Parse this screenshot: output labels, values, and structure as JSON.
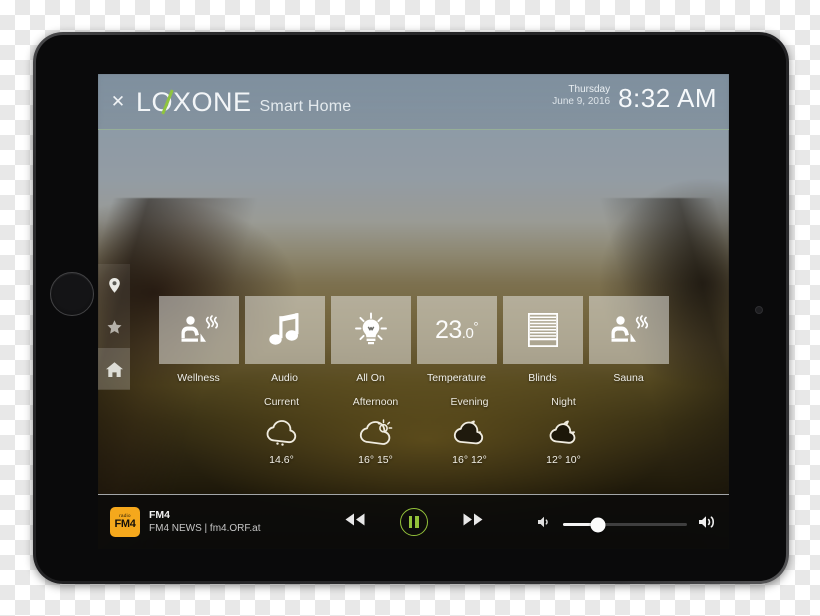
{
  "device": {
    "type": "tablet",
    "orientation": "landscape"
  },
  "header": {
    "close_icon": "close-icon",
    "brand": "LOXONE",
    "brand_accent_color": "#8fc43f",
    "subtitle": "Smart Home",
    "weekday": "Thursday",
    "date": "June 9, 2016",
    "time": "8:32 AM"
  },
  "sidebar": {
    "items": [
      {
        "name": "location",
        "icon": "map-pin-icon",
        "active": false
      },
      {
        "name": "favorites",
        "icon": "star-icon",
        "active": false
      },
      {
        "name": "home",
        "icon": "home-icon",
        "active": true
      }
    ]
  },
  "tiles": [
    {
      "label": "Wellness",
      "icon": "sauna-person-icon"
    },
    {
      "label": "Audio",
      "icon": "music-note-icon"
    },
    {
      "label": "All On",
      "icon": "lightbulb-icon"
    },
    {
      "label": "Temperature",
      "icon": "temperature-value",
      "value_int": "23",
      "value_dec": ".0",
      "value_unit": "°"
    },
    {
      "label": "Blinds",
      "icon": "blinds-icon"
    },
    {
      "label": "Sauna",
      "icon": "sauna-person-icon"
    }
  ],
  "weather": [
    {
      "label": "Current",
      "icon": "cloud-drizzle-icon",
      "temps": "14.6°"
    },
    {
      "label": "Afternoon",
      "icon": "sun-behind-cloud-icon",
      "temps": "16° 15°"
    },
    {
      "label": "Evening",
      "icon": "moon-behind-cloud-icon",
      "temps": "16° 12°"
    },
    {
      "label": "Night",
      "icon": "moon-behind-cloud-icon",
      "temps": "12° 10°"
    }
  ],
  "player": {
    "station_logo_top": "radio",
    "station_logo_main": "FM4",
    "station_logo_color": "#f5a81c",
    "track_title": "FM4",
    "track_subtitle": "FM4 NEWS | fm4.ORF.at",
    "previous_icon": "rewind-icon",
    "play_state_icon": "pause-icon",
    "play_accent_color": "#93c13a",
    "next_icon": "fast-forward-icon",
    "volume_low_icon": "volume-low-icon",
    "volume_high_icon": "volume-high-icon",
    "volume_percent": 28
  }
}
